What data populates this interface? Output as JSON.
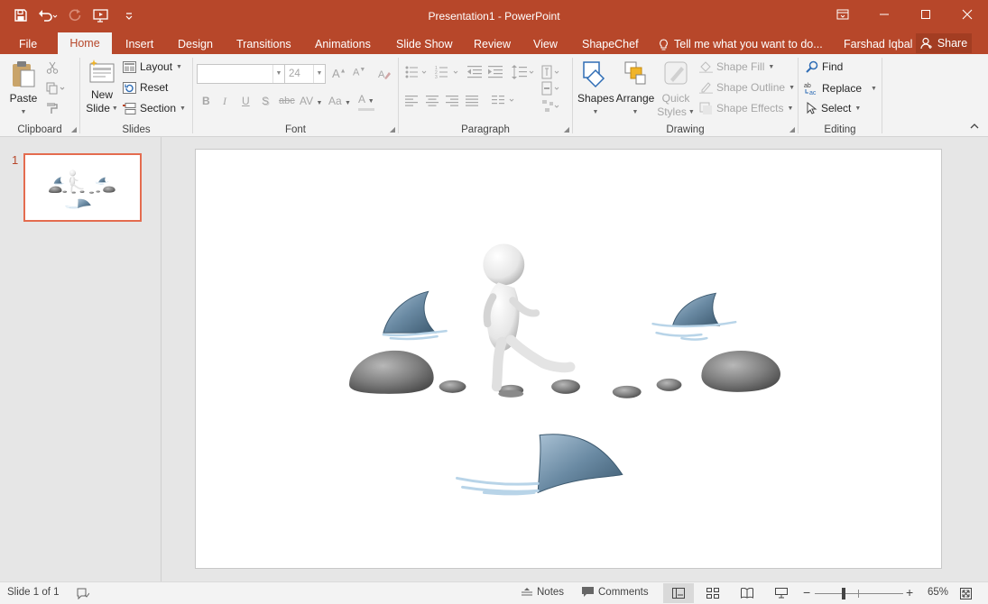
{
  "window": {
    "title": "Presentation1 - PowerPoint",
    "user": "Farshad Iqbal",
    "share_label": "Share"
  },
  "tabs": [
    {
      "label": "File"
    },
    {
      "label": "Home"
    },
    {
      "label": "Insert"
    },
    {
      "label": "Design"
    },
    {
      "label": "Transitions"
    },
    {
      "label": "Animations"
    },
    {
      "label": "Slide Show"
    },
    {
      "label": "Review"
    },
    {
      "label": "View"
    },
    {
      "label": "ShapeChef"
    }
  ],
  "tell_me": "Tell me what you want to do...",
  "ribbon": {
    "clipboard": {
      "label": "Clipboard",
      "paste": "Paste"
    },
    "slides": {
      "label": "Slides",
      "new_slide_1": "New",
      "new_slide_2": "Slide",
      "layout": "Layout",
      "reset": "Reset",
      "section": "Section"
    },
    "font": {
      "label": "Font",
      "size": "24",
      "bold": "B",
      "italic": "I",
      "underline": "U",
      "shadow": "S",
      "strike": "abc",
      "spacing": "AV",
      "case": "Aa"
    },
    "paragraph": {
      "label": "Paragraph"
    },
    "drawing": {
      "label": "Drawing",
      "shapes": "Shapes",
      "arrange": "Arrange",
      "quick_1": "Quick",
      "quick_2": "Styles",
      "fill": "Shape Fill",
      "outline": "Shape Outline",
      "effects": "Shape Effects"
    },
    "editing": {
      "label": "Editing",
      "find": "Find",
      "replace": "Replace",
      "select": "Select"
    }
  },
  "thumbnails": [
    {
      "number": "1"
    }
  ],
  "status": {
    "slide": "Slide 1 of 1",
    "notes": "Notes",
    "comments": "Comments",
    "zoom": "65%",
    "zoom_level": 0.65
  },
  "colors": {
    "accent": "#b7472a",
    "selection": "#e46c4f"
  }
}
